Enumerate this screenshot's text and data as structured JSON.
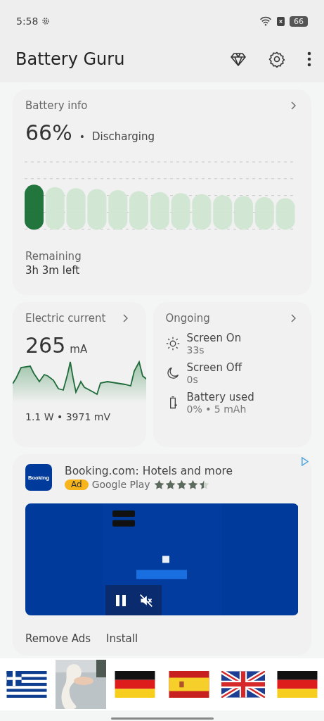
{
  "status_bar": {
    "time": "5:58",
    "battery": "66"
  },
  "app_bar": {
    "title": "Battery Guru"
  },
  "battery_info": {
    "title": "Battery info",
    "percent": "66%",
    "separator": "•",
    "state": "Discharging",
    "remaining_label": "Remaining",
    "remaining_value": "3h 3m left"
  },
  "electric_current": {
    "title": "Electric current",
    "value": "265",
    "unit": "mA",
    "footer": "1.1 W • 3971 mV"
  },
  "ongoing": {
    "title": "Ongoing",
    "items": [
      {
        "kind": "sun",
        "label": "Screen On",
        "value": "33s"
      },
      {
        "kind": "moon",
        "label": "Screen Off",
        "value": "0s"
      },
      {
        "kind": "battery",
        "label": "Battery used",
        "value": "0% • 5 mAh"
      }
    ]
  },
  "ad": {
    "app_icon_text": "Booking",
    "title": "Booking.com: Hotels and more",
    "badge": "Ad",
    "store": "Google Play",
    "stars": 4.5,
    "video": {
      "kind": "picture"
    },
    "actions": [
      "Remove Ads",
      "Install"
    ]
  },
  "product_strip": [
    {
      "kind": "greece"
    },
    {
      "kind": "picture"
    },
    {
      "kind": "germany"
    },
    {
      "kind": "spain"
    },
    {
      "kind": "uk"
    },
    {
      "kind": "germany"
    }
  ]
}
